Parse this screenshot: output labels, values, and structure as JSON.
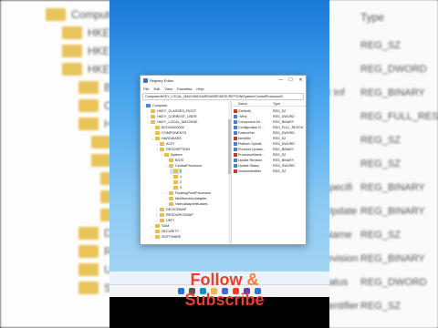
{
  "background": {
    "tree_rows": [
      "Computer",
      "HKEY_CLASS",
      "HKEY_CURRENT",
      "HKEY_LOCA",
      "BCD00000",
      "COMPO",
      "HARDW",
      "ACPI",
      "DESC",
      "Sy",
      "Bl",
      "Ce",
      "DEVIC",
      "RESO",
      "UEFI",
      "SAM"
    ],
    "type_header": "Type",
    "right_rows": [
      {
        "name": "",
        "type": "REG_SZ"
      },
      {
        "name": "",
        "type": "REG_DWORD"
      },
      {
        "name": "nent Inf",
        "type": "REG_BINARY"
      },
      {
        "name": "",
        "type": "REG_FULL_RESOU"
      },
      {
        "name": "let",
        "type": "REG_SZ"
      },
      {
        "name": "",
        "type": "REG_SZ"
      },
      {
        "name": "m Specifi",
        "type": "REG_BINARY"
      },
      {
        "name": "us Update",
        "type": "REG_BINARY"
      },
      {
        "name": "sorName",
        "type": "REG_SZ"
      },
      {
        "name": "e Revision",
        "type": "REG_BINARY"
      },
      {
        "name": "e Status",
        "type": "REG_DWORD"
      },
      {
        "name": "orIdentifier",
        "type": "REG_SZ"
      }
    ]
  },
  "regedit": {
    "title": "Registry Editor",
    "window_controls": [
      "—",
      "☐",
      "✕"
    ],
    "menu": [
      "File",
      "Edit",
      "View",
      "Favorites",
      "Help"
    ],
    "address": "Computer\\HKEY_LOCAL_MACHINE\\HARDWARE\\DESCRIPTION\\System\\CentralProcessor\\0",
    "tree": [
      {
        "label": "Computer",
        "depth": 0,
        "chev": "⌄"
      },
      {
        "label": "HKEY_CLASSES_ROOT",
        "depth": 1,
        "chev": "›"
      },
      {
        "label": "HKEY_CURRENT_USER",
        "depth": 1,
        "chev": "›"
      },
      {
        "label": "HKEY_LOCAL_MACHINE",
        "depth": 1,
        "chev": "⌄"
      },
      {
        "label": "BCD00000000",
        "depth": 2,
        "chev": "›"
      },
      {
        "label": "COMPONENTS",
        "depth": 2,
        "chev": "›"
      },
      {
        "label": "HARDWARE",
        "depth": 2,
        "chev": "⌄"
      },
      {
        "label": "ACPI",
        "depth": 3,
        "chev": "›"
      },
      {
        "label": "DESCRIPTION",
        "depth": 3,
        "chev": "⌄"
      },
      {
        "label": "System",
        "depth": 4,
        "chev": "⌄"
      },
      {
        "label": "BIOS",
        "depth": 5,
        "chev": ""
      },
      {
        "label": "CentralProcessor",
        "depth": 5,
        "chev": "⌄"
      },
      {
        "label": "0",
        "depth": 6,
        "chev": "",
        "selected": true
      },
      {
        "label": "1",
        "depth": 6,
        "chev": ""
      },
      {
        "label": "2",
        "depth": 6,
        "chev": ""
      },
      {
        "label": "3",
        "depth": 6,
        "chev": ""
      },
      {
        "label": "FloatingPointProcessor",
        "depth": 5,
        "chev": "›"
      },
      {
        "label": "MultifunctionAdapter",
        "depth": 5,
        "chev": "›"
      },
      {
        "label": "VideoAdapterBusses",
        "depth": 5,
        "chev": ""
      },
      {
        "label": "DEVICEMAP",
        "depth": 3,
        "chev": "›"
      },
      {
        "label": "RESOURCEMAP",
        "depth": 3,
        "chev": "›"
      },
      {
        "label": "UEFI",
        "depth": 3,
        "chev": "›"
      },
      {
        "label": "SAM",
        "depth": 2,
        "chev": "›"
      },
      {
        "label": "SECURITY",
        "depth": 2,
        "chev": ""
      },
      {
        "label": "SOFTWARE",
        "depth": 2,
        "chev": "›"
      }
    ],
    "columns": {
      "name": "Name",
      "type": "Type"
    },
    "values": [
      {
        "name": "(Default)",
        "type": "REG_SZ"
      },
      {
        "name": "~MHz",
        "type": "REG_DWORD"
      },
      {
        "name": "Component Inf...",
        "type": "REG_BINARY"
      },
      {
        "name": "Configuration D...",
        "type": "REG_FULL_RESOU"
      },
      {
        "name": "FeatureSet",
        "type": "REG_DWORD"
      },
      {
        "name": "Identifier",
        "type": "REG_SZ"
      },
      {
        "name": "Platform Specifi...",
        "type": "REG_DWORD"
      },
      {
        "name": "Previous Update...",
        "type": "REG_BINARY"
      },
      {
        "name": "ProcessorName...",
        "type": "REG_SZ"
      },
      {
        "name": "Update Revision",
        "type": "REG_BINARY"
      },
      {
        "name": "Update Status",
        "type": "REG_DWORD"
      },
      {
        "name": "VendorIdentifier",
        "type": "REG_SZ"
      }
    ]
  },
  "taskbar_icons": [
    {
      "name": "start-icon",
      "color": "#1a73e8"
    },
    {
      "name": "search-icon",
      "color": "#555555"
    },
    {
      "name": "edge-icon",
      "color": "#0f8ed8"
    },
    {
      "name": "explorer-icon",
      "color": "#f3b73b"
    },
    {
      "name": "store-icon",
      "color": "#3b6ed8"
    },
    {
      "name": "chrome-icon",
      "color": "#e8402a"
    },
    {
      "name": "app-icon",
      "color": "#6a3fb0"
    },
    {
      "name": "regedit-icon",
      "color": "#2b78d0"
    }
  ],
  "cta": {
    "line1_a": "Follow ",
    "amp": "&",
    "line2": "Subscribe"
  }
}
